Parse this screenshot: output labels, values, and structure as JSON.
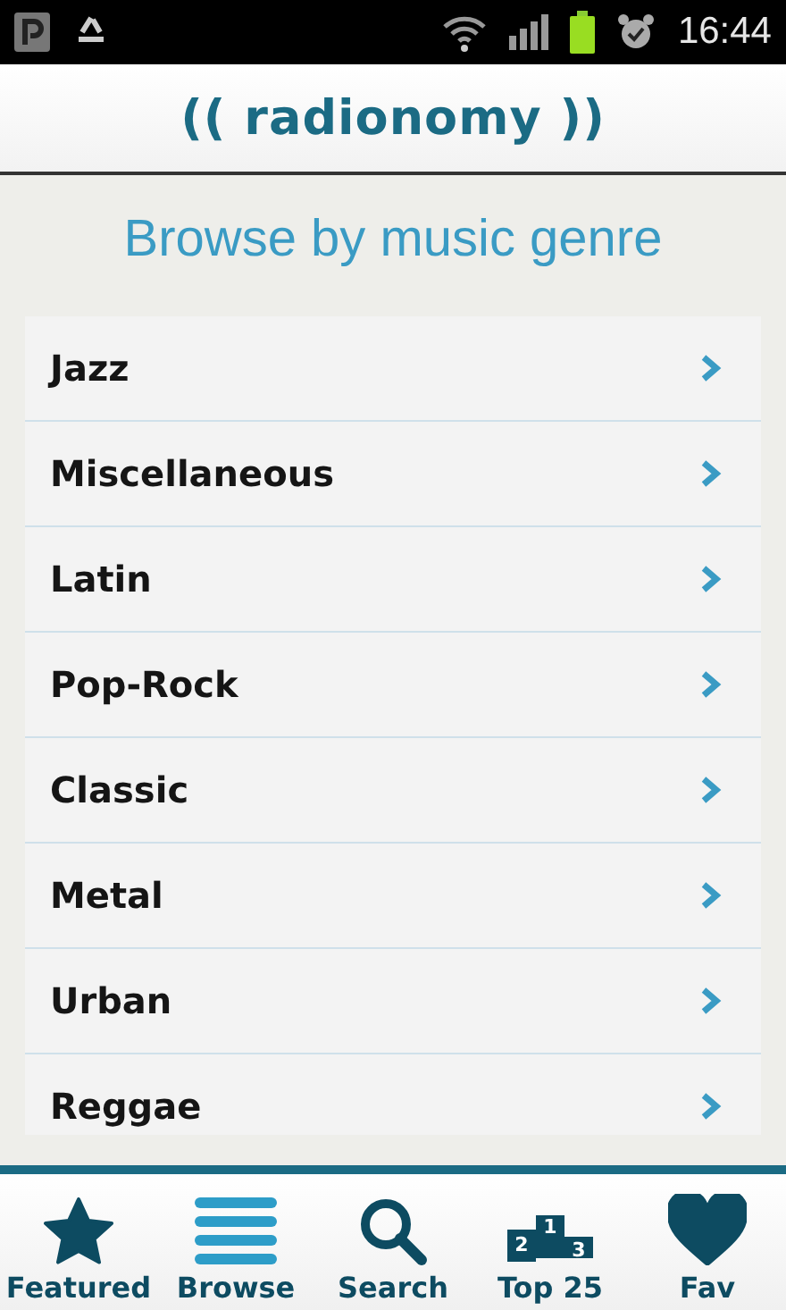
{
  "status_bar": {
    "time": "16:44"
  },
  "header": {
    "logo": "(( radionomy ))"
  },
  "title": "Browse by music genre",
  "genres": [
    {
      "label": "Jazz"
    },
    {
      "label": "Miscellaneous"
    },
    {
      "label": "Latin"
    },
    {
      "label": "Pop-Rock"
    },
    {
      "label": "Classic"
    },
    {
      "label": "Metal"
    },
    {
      "label": "Urban"
    },
    {
      "label": "Reggae"
    }
  ],
  "tabs": [
    {
      "label": "Featured",
      "kind": "star",
      "selected": false
    },
    {
      "label": "Browse",
      "kind": "list",
      "selected": true
    },
    {
      "label": "Search",
      "kind": "search",
      "selected": false
    },
    {
      "label": "Top 25",
      "kind": "podium",
      "selected": false,
      "icon_text": [
        "2",
        "1",
        "3"
      ]
    },
    {
      "label": "Fav",
      "kind": "heart",
      "selected": false
    }
  ]
}
